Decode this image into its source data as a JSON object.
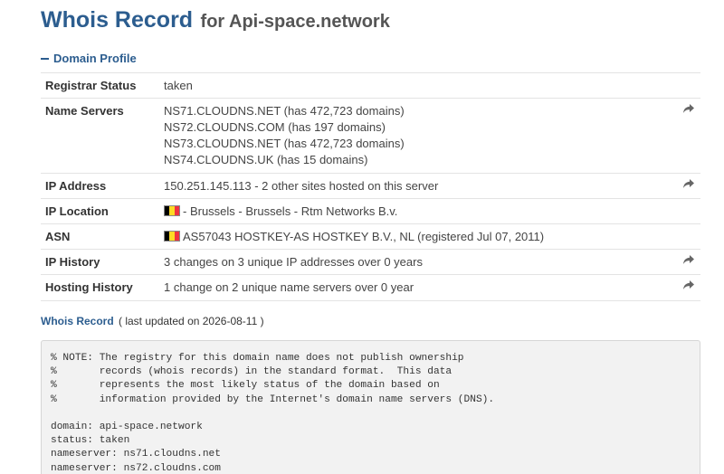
{
  "title": {
    "main": "Whois Record",
    "sub": "for Api-space.network"
  },
  "profile": {
    "toggle_label": "Domain Profile",
    "rows": [
      {
        "label": "Registrar Status",
        "lines": [
          "taken"
        ],
        "share": false
      },
      {
        "label": "Name Servers",
        "lines": [
          "NS71.CLOUDNS.NET (has 472,723 domains)",
          "NS72.CLOUDNS.COM (has 197 domains)",
          "NS73.CLOUDNS.NET (has 472,723 domains)",
          "NS74.CLOUDNS.UK (has 15 domains)"
        ],
        "share": true
      },
      {
        "label": "IP Address",
        "lines": [
          "150.251.145.113 - 2 other sites hosted on this server"
        ],
        "share": true
      },
      {
        "label": "IP Location",
        "lines": [
          "- Brussels - Brussels - Rtm Networks B.v."
        ],
        "flag": "BE",
        "share": false
      },
      {
        "label": "ASN",
        "lines": [
          "AS57043 HOSTKEY-AS HOSTKEY B.V., NL (registered Jul 07, 2011)"
        ],
        "flag": "BE",
        "share": false
      },
      {
        "label": "IP History",
        "lines": [
          "3 changes on 3 unique IP addresses over 0 years"
        ],
        "share": true
      },
      {
        "label": "Hosting History",
        "lines": [
          "1 change on 2 unique name servers over 0 year"
        ],
        "share": true
      }
    ]
  },
  "whois": {
    "title": "Whois Record",
    "updated": "( last updated on 2026-08-11 )",
    "raw": "% NOTE: The registry for this domain name does not publish ownership\n%       records (whois records) in the standard format.  This data\n%       represents the most likely status of the domain based on\n%       information provided by the Internet's domain name servers (DNS).\n\ndomain: api-space.network\nstatus: taken\nnameserver: ns71.cloudns.net\nnameserver: ns72.cloudns.com"
  },
  "colors": {
    "accent": "#2c5d8f",
    "border": "#e3e3e3",
    "raw_bg": "#f2f2f2",
    "flag_black": "#000000",
    "flag_yellow": "#fdda24",
    "flag_red": "#ef3340"
  },
  "icons": {
    "share": "share-arrow-icon",
    "collapse": "minus-icon",
    "flag": "belgium-flag-icon"
  }
}
